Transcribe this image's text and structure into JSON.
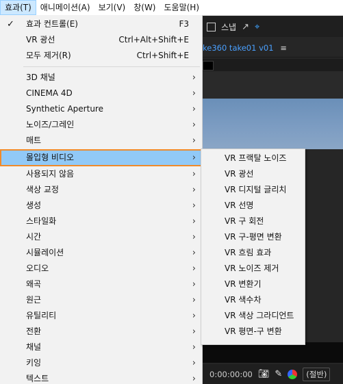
{
  "menubar": {
    "items": [
      {
        "label": "효과(T)",
        "active": true
      },
      {
        "label": "애니메이션(A)",
        "active": false
      },
      {
        "label": "보기(V)",
        "active": false
      },
      {
        "label": "창(W)",
        "active": false
      },
      {
        "label": "도움말(H)",
        "active": false
      }
    ]
  },
  "effects_menu": {
    "top_items": [
      {
        "label": "효과 컨트롤(E)",
        "shortcut": "F3",
        "checked": true
      },
      {
        "label": "VR 광선",
        "shortcut": "Ctrl+Alt+Shift+E",
        "checked": false
      },
      {
        "label": "모두 제거(R)",
        "shortcut": "Ctrl+Shift+E",
        "checked": false
      }
    ],
    "categories": [
      {
        "label": "3D 채널"
      },
      {
        "label": "CINEMA 4D"
      },
      {
        "label": "Synthetic Aperture"
      },
      {
        "label": "노이즈/그레인"
      },
      {
        "label": "매트"
      },
      {
        "label": "몰입형 비디오",
        "highlighted": true
      },
      {
        "label": "사용되지 않음"
      },
      {
        "label": "색상 교정"
      },
      {
        "label": "생성"
      },
      {
        "label": "스타일화"
      },
      {
        "label": "시간"
      },
      {
        "label": "시뮬레이션"
      },
      {
        "label": "오디오"
      },
      {
        "label": "왜곡"
      },
      {
        "label": "원근"
      },
      {
        "label": "유틸리티"
      },
      {
        "label": "전환"
      },
      {
        "label": "채널"
      },
      {
        "label": "키잉"
      },
      {
        "label": "텍스트"
      }
    ],
    "submenu_arrow": "›"
  },
  "immersive_submenu": {
    "items": [
      "VR 프랙탈 노이즈",
      "VR 광선",
      "VR 디지털 글리치",
      "VR 선명",
      "VR 구 회전",
      "VR 구-평면 변환",
      "VR 흐림 효과",
      "VR 노이즈 제거",
      "VR 변환기",
      "VR 색수차",
      "VR 색상 그라디언트",
      "VR 평면-구 변환"
    ]
  },
  "background": {
    "toolbar_snap_label": "스냅",
    "comp_tab_label": "ke360 take01 v01",
    "comp_tab_menu_icon": "≡",
    "timecode": "0:00:00:00",
    "resolution_label": "(절반)"
  },
  "colors": {
    "highlight_fill": "#91c9f7",
    "highlight_border": "#f08a2a",
    "menu_bg": "#f2f2f2",
    "app_bg": "#232323",
    "accent_blue": "#4aa0ff"
  }
}
